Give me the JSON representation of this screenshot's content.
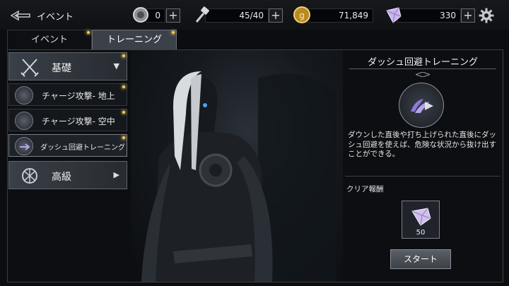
{
  "header": {
    "title": "イベント",
    "back_icon": "back-arrow-icon",
    "resources": [
      {
        "name": "silver-coin",
        "icon": "silver-coin-icon",
        "value": "0"
      },
      {
        "name": "stamina",
        "icon": "hammer-icon",
        "value": "45/40"
      },
      {
        "name": "gold",
        "icon": "gold-coin-icon",
        "value": "71,849"
      },
      {
        "name": "crystal",
        "icon": "crystal-icon",
        "value": "330"
      }
    ],
    "settings_icon": "gear-icon"
  },
  "tabs": [
    {
      "label": "イベント",
      "active": false
    },
    {
      "label": "トレーニング",
      "active": true
    }
  ],
  "sidebar": {
    "categories": [
      {
        "label": "基礎",
        "arrow": "▼",
        "icon": "crossed-swords-icon",
        "expanded": true
      },
      {
        "label": "高級",
        "arrow": "▶",
        "icon": "emblem-icon",
        "expanded": false
      }
    ],
    "items": [
      {
        "label": "チャージ攻撃- 地上",
        "icon": "charge-ground-icon"
      },
      {
        "label": "チャージ攻撃- 空中",
        "icon": "charge-air-icon"
      },
      {
        "label": "ダッシュ回避トレーニング",
        "icon": "dash-icon",
        "selected": true
      }
    ]
  },
  "detail": {
    "title": "ダッシュ回避トレーニング",
    "skill_icon": "dash-evade-icon",
    "description": "ダウンした直後や打ち上げられた直後にダッシュ回避を使えば、危険な状況から抜け出すことができる。",
    "reward_label": "クリア報酬",
    "reward": {
      "icon": "crystal-icon",
      "count": "50"
    },
    "start_label": "スタート"
  },
  "colors": {
    "accent_dot": "#f2c85a",
    "panel_border": "#3a3e45",
    "crystal": "#c9b3f0"
  }
}
